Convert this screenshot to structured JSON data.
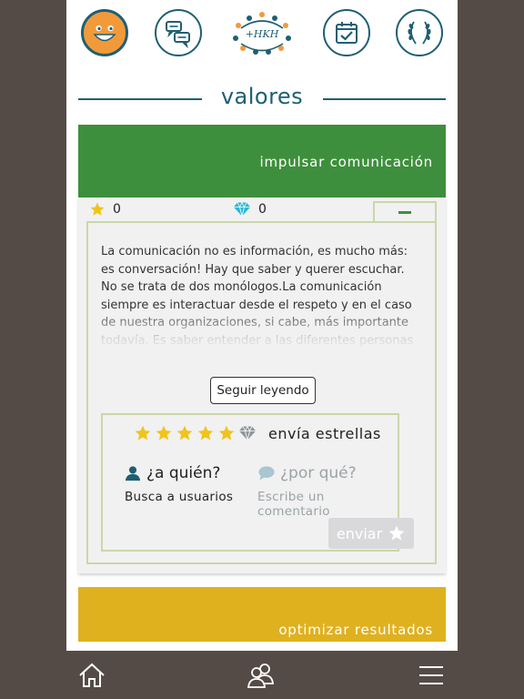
{
  "section": {
    "title": "valores"
  },
  "nav": {
    "icons": [
      "smiley-icon",
      "chat-icon",
      "team-logo-icon",
      "calendar-check-icon",
      "laurel-icon"
    ],
    "logo_text": "+HKH"
  },
  "value_card": {
    "title": "impulsar comunicación",
    "color": "#3e8f3d",
    "stars_count": "0",
    "diamonds_count": "0",
    "description": "La comunicación no es información, es mucho más: es conversación! Hay que saber y querer escuchar. No se trata de dos monólogos.La comunicación siempre es interactuar desde el respeto y en el caso de nuestra organizaciones, si cabe, más importante todavía. Es saber entender a las diferentes personas de las diferentes áreas y de los diferentes centros (si los",
    "read_more": "Seguir leyendo",
    "give": {
      "stars_label": "envía estrellas",
      "selected_stars": 5,
      "who_label": "¿a quién?",
      "who_action": "Busca a usuarios",
      "why_label": "¿por qué?",
      "why_placeholder": "Escribe un comentario",
      "send_label": "enviar"
    }
  },
  "next_card": {
    "title": "optimizar resultados",
    "color": "#dfb11f"
  },
  "bottom_nav": [
    "home-icon",
    "users-icon",
    "menu-icon"
  ]
}
